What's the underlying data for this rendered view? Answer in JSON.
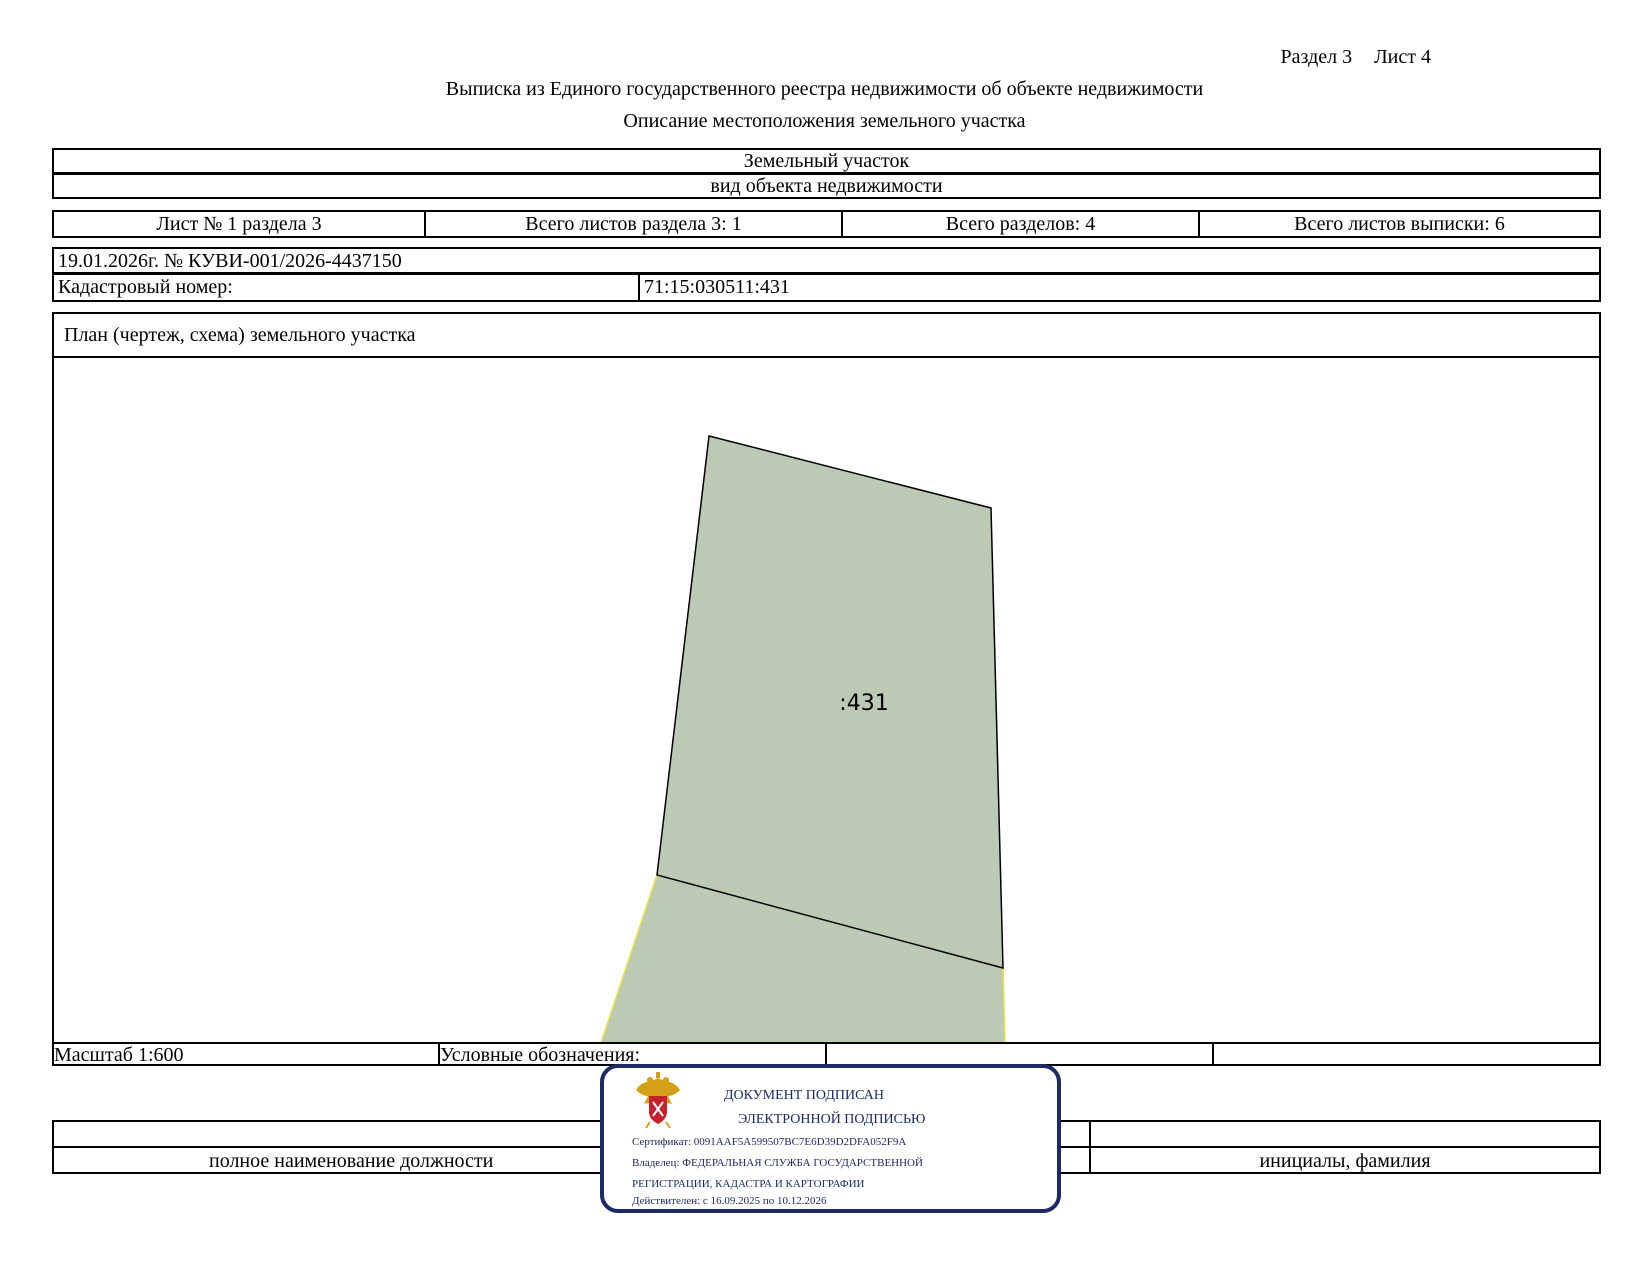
{
  "header": {
    "section": "Раздел 3",
    "sheet": "Лист 4",
    "title": "Выписка из Единого государственного реестра недвижимости об объекте недвижимости",
    "subtitle": "Описание местоположения земельного участка"
  },
  "object": {
    "type": "Земельный участок",
    "type_caption": "вид объекта недвижимости"
  },
  "sheets": {
    "sheet_no": "Лист № 1 раздела 3",
    "total_section_sheets": "Всего листов раздела 3: 1",
    "total_sections": "Всего разделов: 4",
    "total_extract_sheets": "Всего листов выписки: 6"
  },
  "record": {
    "date_number": "19.01.2026г. № КУВИ-001/2026-4437150",
    "cadastral_label": "Кадастровый номер:",
    "cadastral_value": "71:15:030511:431"
  },
  "plan": {
    "heading": "План (чертеж, схема) земельного участка",
    "parcel_label": ":431",
    "parcel_fill": "#bcc9b4",
    "neighbor_edge": "#e6e23c"
  },
  "legend": {
    "scale": "Масштаб 1:600",
    "symbols_label": "Условные обозначения:"
  },
  "signature": {
    "position_caption": "полное наименование должности",
    "name_caption": "инициалы, фамилия"
  },
  "stamp": {
    "title_line1": "ДОКУМЕНТ ПОДПИСАН",
    "title_line2": "ЭЛЕКТРОННОЙ ПОДПИСЬЮ",
    "certificate": "Сертификат: 0091AAF5A599507BC7E6D39D2DFA052F9A",
    "owner_line1": "Владелец: ФЕДЕРАЛЬНАЯ СЛУЖБА ГОСУДАРСТВЕННОЙ",
    "owner_line2": "РЕГИСТРАЦИИ, КАДАСТРА И КАРТОГРАФИИ",
    "validity": "Действителен: с 16.09.2025 по 10.12.2026",
    "color": "#1c2a66",
    "emblem": "russian-coat-of-arms-icon"
  }
}
